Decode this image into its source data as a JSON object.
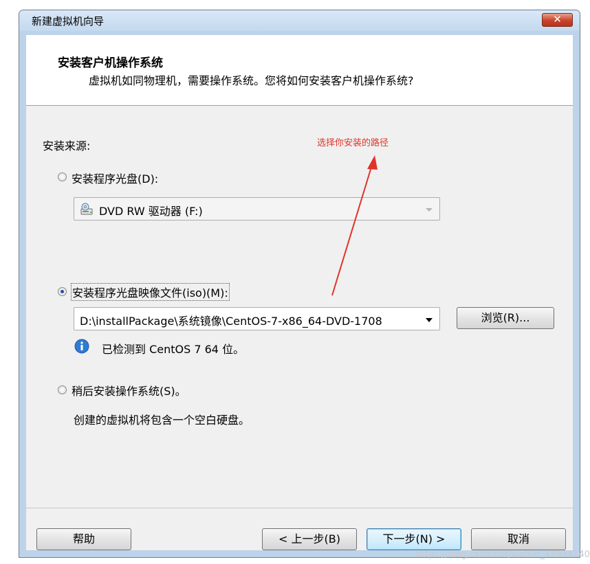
{
  "window": {
    "title": "新建虚拟机向导",
    "close_label": "✕"
  },
  "header": {
    "title": "安装客户机操作系统",
    "subtitle": "虚拟机如同物理机，需要操作系统。您将如何安装客户机操作系统?"
  },
  "source_label": "安装来源:",
  "annotation": {
    "text": "选择你安装的路径",
    "color": "#e0332a"
  },
  "options": {
    "disc": {
      "label": "安装程序光盘(D):",
      "selected": false,
      "drive_value": "DVD RW 驱动器 (F:)"
    },
    "iso": {
      "label": "安装程序光盘映像文件(iso)(M):",
      "selected": true,
      "path_value": "D:\\installPackage\\系统镜像\\CentOS-7-x86_64-DVD-1708",
      "browse_label": "浏览(R)...",
      "detected_text": "已检测到 CentOS 7 64 位。"
    },
    "later": {
      "label": "稍后安装操作系统(S)。",
      "selected": false,
      "description": "创建的虚拟机将包含一个空白硬盘。"
    }
  },
  "footer": {
    "help": "帮助",
    "back": "< 上一步(B)",
    "next": "下一步(N) >",
    "cancel": "取消"
  },
  "watermark": "https://blog.csdn.net/weixin_43934140"
}
